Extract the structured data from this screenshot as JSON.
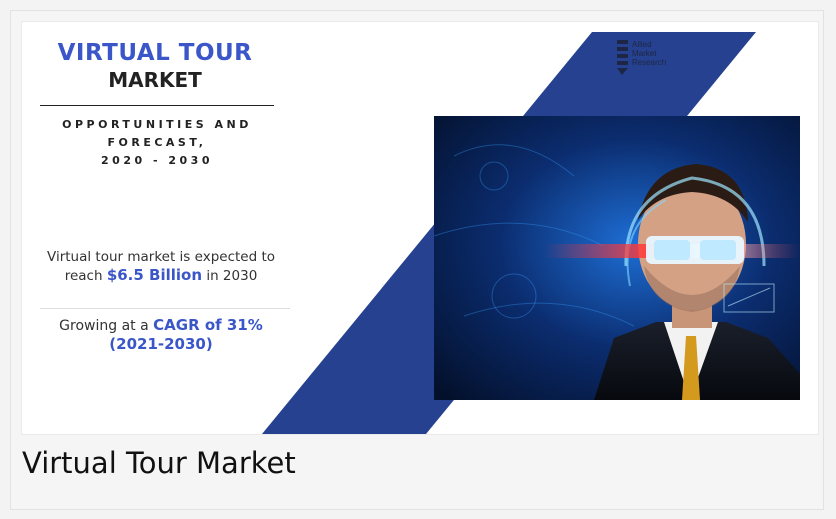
{
  "infographic": {
    "title_line1": "VIRTUAL TOUR",
    "title_line2": "MARKET",
    "subtitle_lines": [
      "OPPORTUNITIES AND",
      "FORECAST,",
      "2020 - 2030"
    ],
    "stat1": {
      "prefix": "Virtual tour market is expected to reach",
      "highlight": "$6.5 Billion",
      "suffix": "in 2030"
    },
    "stat2": {
      "prefix": "Growing at a",
      "highlight": "CAGR of 31%",
      "period": "(2021-2030)"
    },
    "logo_lines": [
      "Allied",
      "Market",
      "Research"
    ],
    "colors": {
      "accent": "#3b56c8",
      "stripe": "#26418f"
    }
  },
  "caption": "Virtual Tour Market"
}
